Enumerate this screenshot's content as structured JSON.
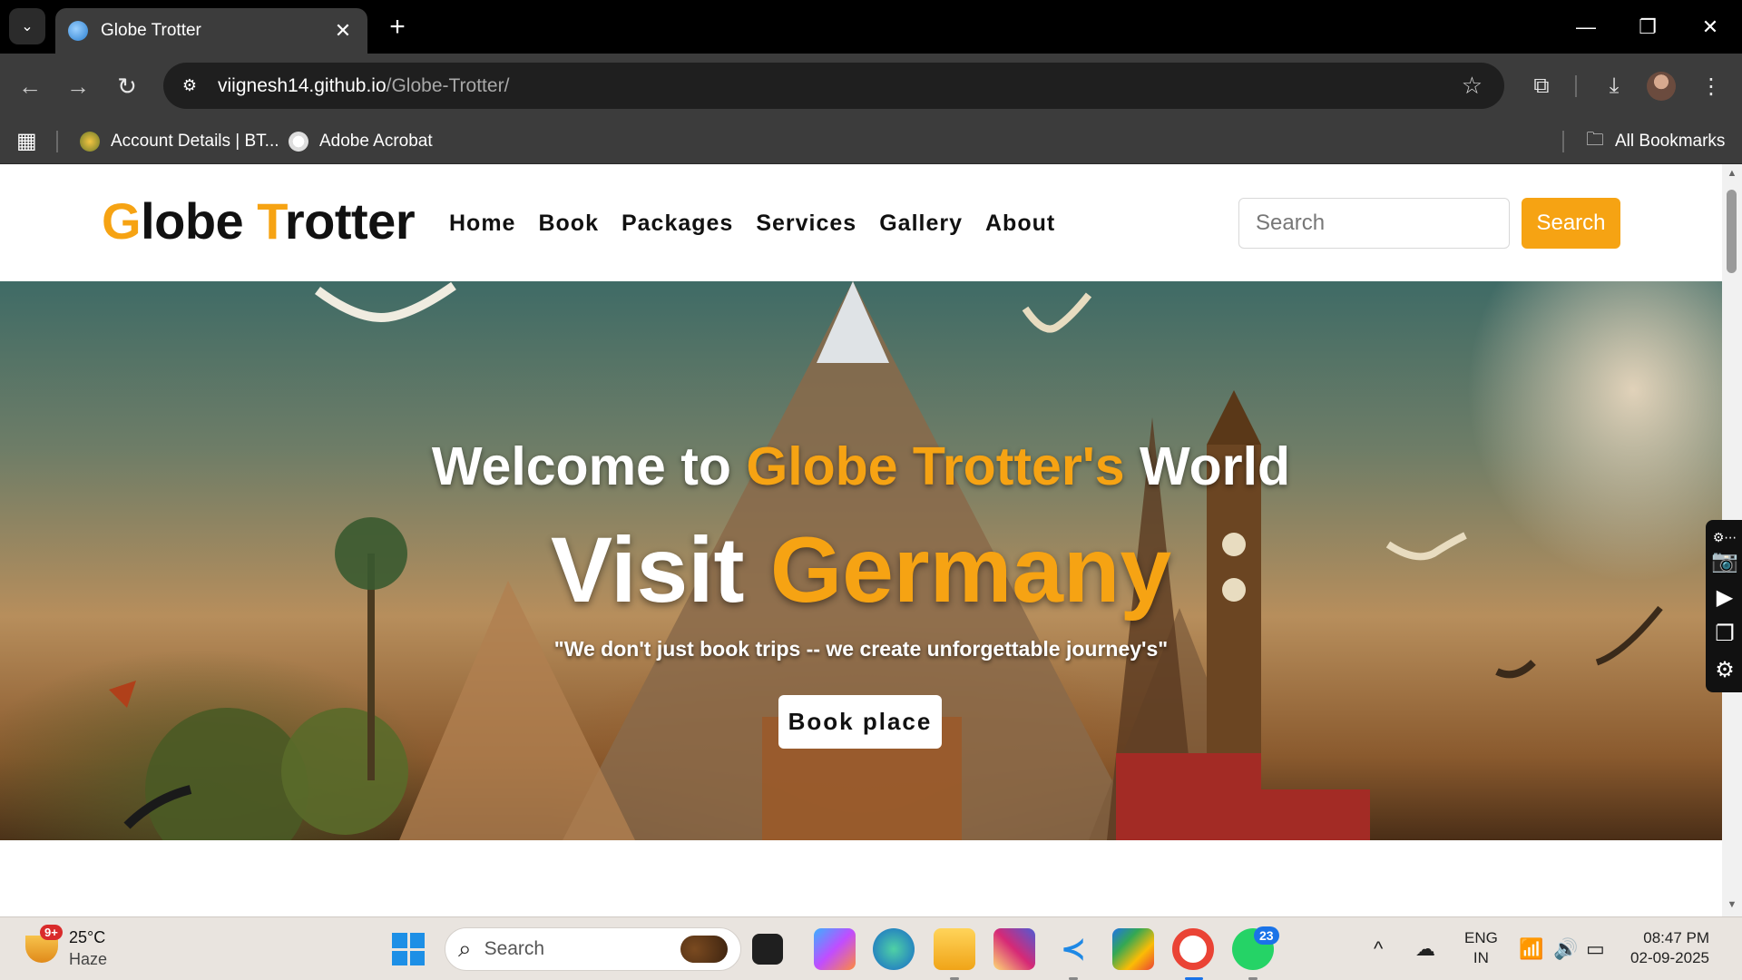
{
  "browser": {
    "tab_title": "Globe Trotter",
    "tab_close": "✕",
    "new_tab": "+",
    "url_host": "viignesh14.github.io",
    "url_path": "/Globe-Trotter/",
    "window_controls": [
      "—",
      "❐",
      "✕"
    ],
    "bookmarks": [
      {
        "label": "Account Details | BT...",
        "icon": "bt-favicon-icon"
      },
      {
        "label": "Adobe Acrobat",
        "icon": "globe-icon"
      }
    ],
    "all_bookmarks": "All Bookmarks"
  },
  "site": {
    "logo_first_letter": "G",
    "logo_rest_1": "lobe ",
    "logo_second_letter": "T",
    "logo_rest_2": "rotter",
    "nav": [
      "Home",
      "Book",
      "Packages",
      "Services",
      "Gallery",
      "About"
    ],
    "search_placeholder": "Search",
    "search_button": "Search",
    "accent_color": "#f6a313"
  },
  "hero": {
    "welcome_prefix": "Welcome to ",
    "welcome_accent": "Globe Trotter's",
    "welcome_suffix": " World",
    "visit_prefix": "Visit ",
    "visit_accent": "Germany",
    "tagline": "\"We don't just book trips -- we create unforgettable journey's\"",
    "cta": "Book place"
  },
  "taskbar": {
    "weather_badge": "9+",
    "temperature": "25°C",
    "condition": "Haze",
    "search_placeholder": "Search",
    "whatsapp_badge": "23",
    "lang_line1": "ENG",
    "lang_line2": "IN",
    "time": "08:47 PM",
    "date": "02-09-2025"
  }
}
